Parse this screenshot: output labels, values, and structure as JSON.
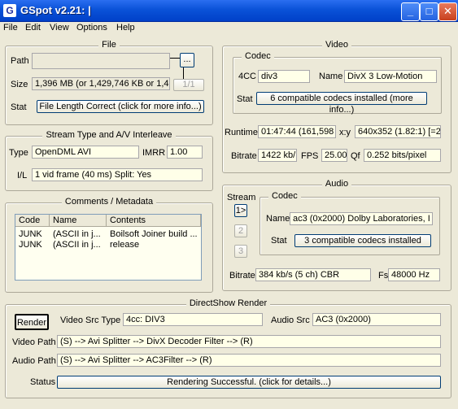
{
  "window": {
    "title": "GSpot v2.21: |",
    "buttons": {
      "minimize": "_",
      "maximize": "□",
      "close": "✕"
    }
  },
  "menu": [
    "File",
    "Edit",
    "View",
    "Options",
    "Help"
  ],
  "file": {
    "title": "File",
    "path_label": "Path",
    "path_value": "",
    "browse_label": "...",
    "size_label": "Size",
    "size_value": "1,396 MB (or 1,429,746 KB or 1,4",
    "page_label": "1/1",
    "stat_label": "Stat",
    "stat_value": "File Length Correct (click for more info...)"
  },
  "stream": {
    "title": "Stream Type and A/V Interleave",
    "type_label": "Type",
    "type_value": "OpenDML AVI",
    "imrr_label": "IMRR",
    "imrr_value": "1.00",
    "il_label": "I/L",
    "il_value": "1 vid frame (40 ms)  Split: Yes"
  },
  "comments": {
    "title": "Comments / Metadata",
    "columns": [
      "Code",
      "Name",
      "Contents"
    ],
    "rows": [
      [
        "JUNK",
        "(ASCII in j...",
        "Boilsoft Joiner build ..."
      ],
      [
        "JUNK",
        "(ASCII in j...",
        "release"
      ]
    ]
  },
  "video": {
    "title": "Video",
    "codec_title": "Codec",
    "fourcc_label": "4CC",
    "fourcc_value": "div3",
    "name_label": "Name",
    "name_value": "DivX 3 Low-Motion",
    "stat_label": "Stat",
    "stat_value": "6 compatible codecs installed (more info...)",
    "runtime_label": "Runtime",
    "runtime_value": "01:47:44 (161,598",
    "xy_label": "x:y",
    "xy_value": "640x352 (1.82:1) [=20",
    "bitrate_label": "Bitrate",
    "bitrate_value": "1422 kb/",
    "fps_label": "FPS",
    "fps_value": "25.00",
    "qf_label": "Qf",
    "qf_value": "0.252 bits/pixel"
  },
  "audio": {
    "title": "Audio",
    "stream_label": "Stream",
    "streams": [
      "1>",
      "2",
      "3"
    ],
    "codec_title": "Codec",
    "name_label": "Name",
    "name_value": "ac3 (0x2000) Dolby Laboratories, I",
    "stat_label": "Stat",
    "stat_value": "3 compatible codecs installed",
    "bitrate_label": "Bitrate",
    "bitrate_value": "384 kb/s (5 ch) CBR",
    "fs_label": "Fs",
    "fs_value": "48000 Hz"
  },
  "render": {
    "title": "DirectShow Render",
    "render_button": "Render",
    "vsrc_label": "Video Src Type",
    "vsrc_value": "4cc: DIV3",
    "asrc_label": "Audio Src",
    "asrc_value": "AC3 (0x2000)",
    "vpath_label": "Video Path",
    "vpath_value": "(S) --> Avi Splitter --> DivX Decoder Filter --> (R)",
    "apath_label": "Audio Path",
    "apath_value": "(S) --> Avi Splitter --> AC3Filter --> (R)",
    "status_label": "Status",
    "status_value": "Rendering Successful.  (click for details...)"
  }
}
